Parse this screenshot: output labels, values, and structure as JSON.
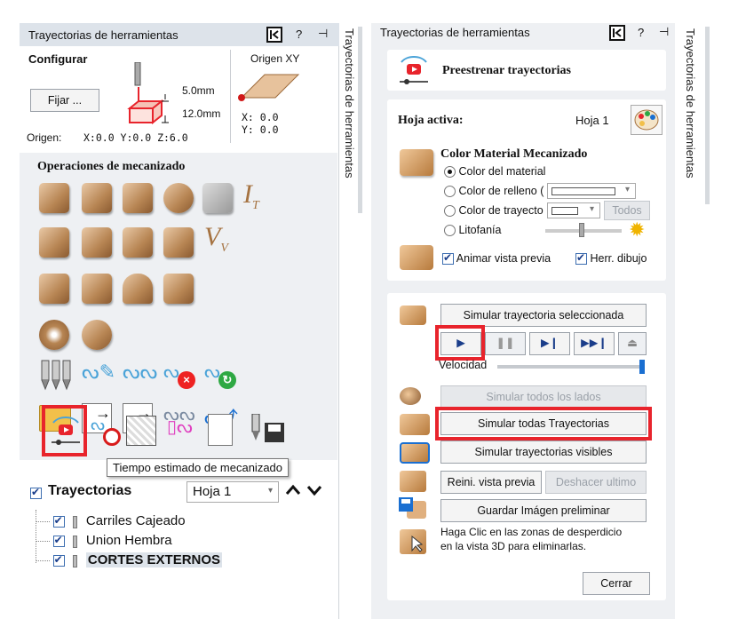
{
  "left": {
    "title": "Trayectorias de herramientas",
    "help": "?",
    "pin": "⊣",
    "configurar": "Configurar",
    "fijar": "Fijar ...",
    "dim_top": "5.0mm",
    "dim_bottom": "12.0mm",
    "origen_xy": "Origen XY",
    "xy_x": "X: 0.0",
    "xy_y": "Y: 0.0",
    "origen_label": "Origen:",
    "origen_value": "X:0.0 Y:0.0 Z:6.0",
    "ops_title": "Operaciones de mecanizado",
    "tooltip": "Tiempo estimado de mecanizado",
    "tray_label": "Trayectorias",
    "sheet_value": "Hoja 1",
    "items": [
      "Carriles Cajeado",
      "Union Hembra",
      "CORTES EXTERNOS"
    ],
    "side_tab": "Trayectorias de herramientas"
  },
  "right": {
    "title": "Trayectorias de herramientas",
    "help": "?",
    "pin": "⊣",
    "preview_title": "Preestrenar trayectorias",
    "hoja_activa": "Hoja activa:",
    "hoja_value": "Hoja 1",
    "color_title": "Color Material Mecanizado",
    "opt_material": "Color del material",
    "opt_relleno": "Color de relleno (",
    "opt_trayecto": "Color de trayecto",
    "todos": "Todos",
    "opt_litofania": "Litofanía",
    "animar": "Animar vista previa",
    "herr": "Herr. dibujo",
    "sim_sel": "Simular trayectoria seleccionada",
    "velocidad": "Velocidad",
    "sim_lados": "Simular todos los lados",
    "sim_todas": "Simular todas Trayectorias",
    "sim_visibles": "Simular trayectorias visibles",
    "reini": "Reini. vista previa",
    "deshacer": "Deshacer ultimo",
    "guardar": "Guardar Imágen preliminar",
    "haga_1": "Haga Clic en las zonas de desperdicio",
    "haga_2": "en la vista 3D para eliminarlas.",
    "cerrar": "Cerrar",
    "side_tab": "Trayectorias de herramientas"
  },
  "colors": {
    "highlight": "#e8242c",
    "accent": "#1a6fd1",
    "wood": "#b78553"
  },
  "speed_fraction": 1.0
}
